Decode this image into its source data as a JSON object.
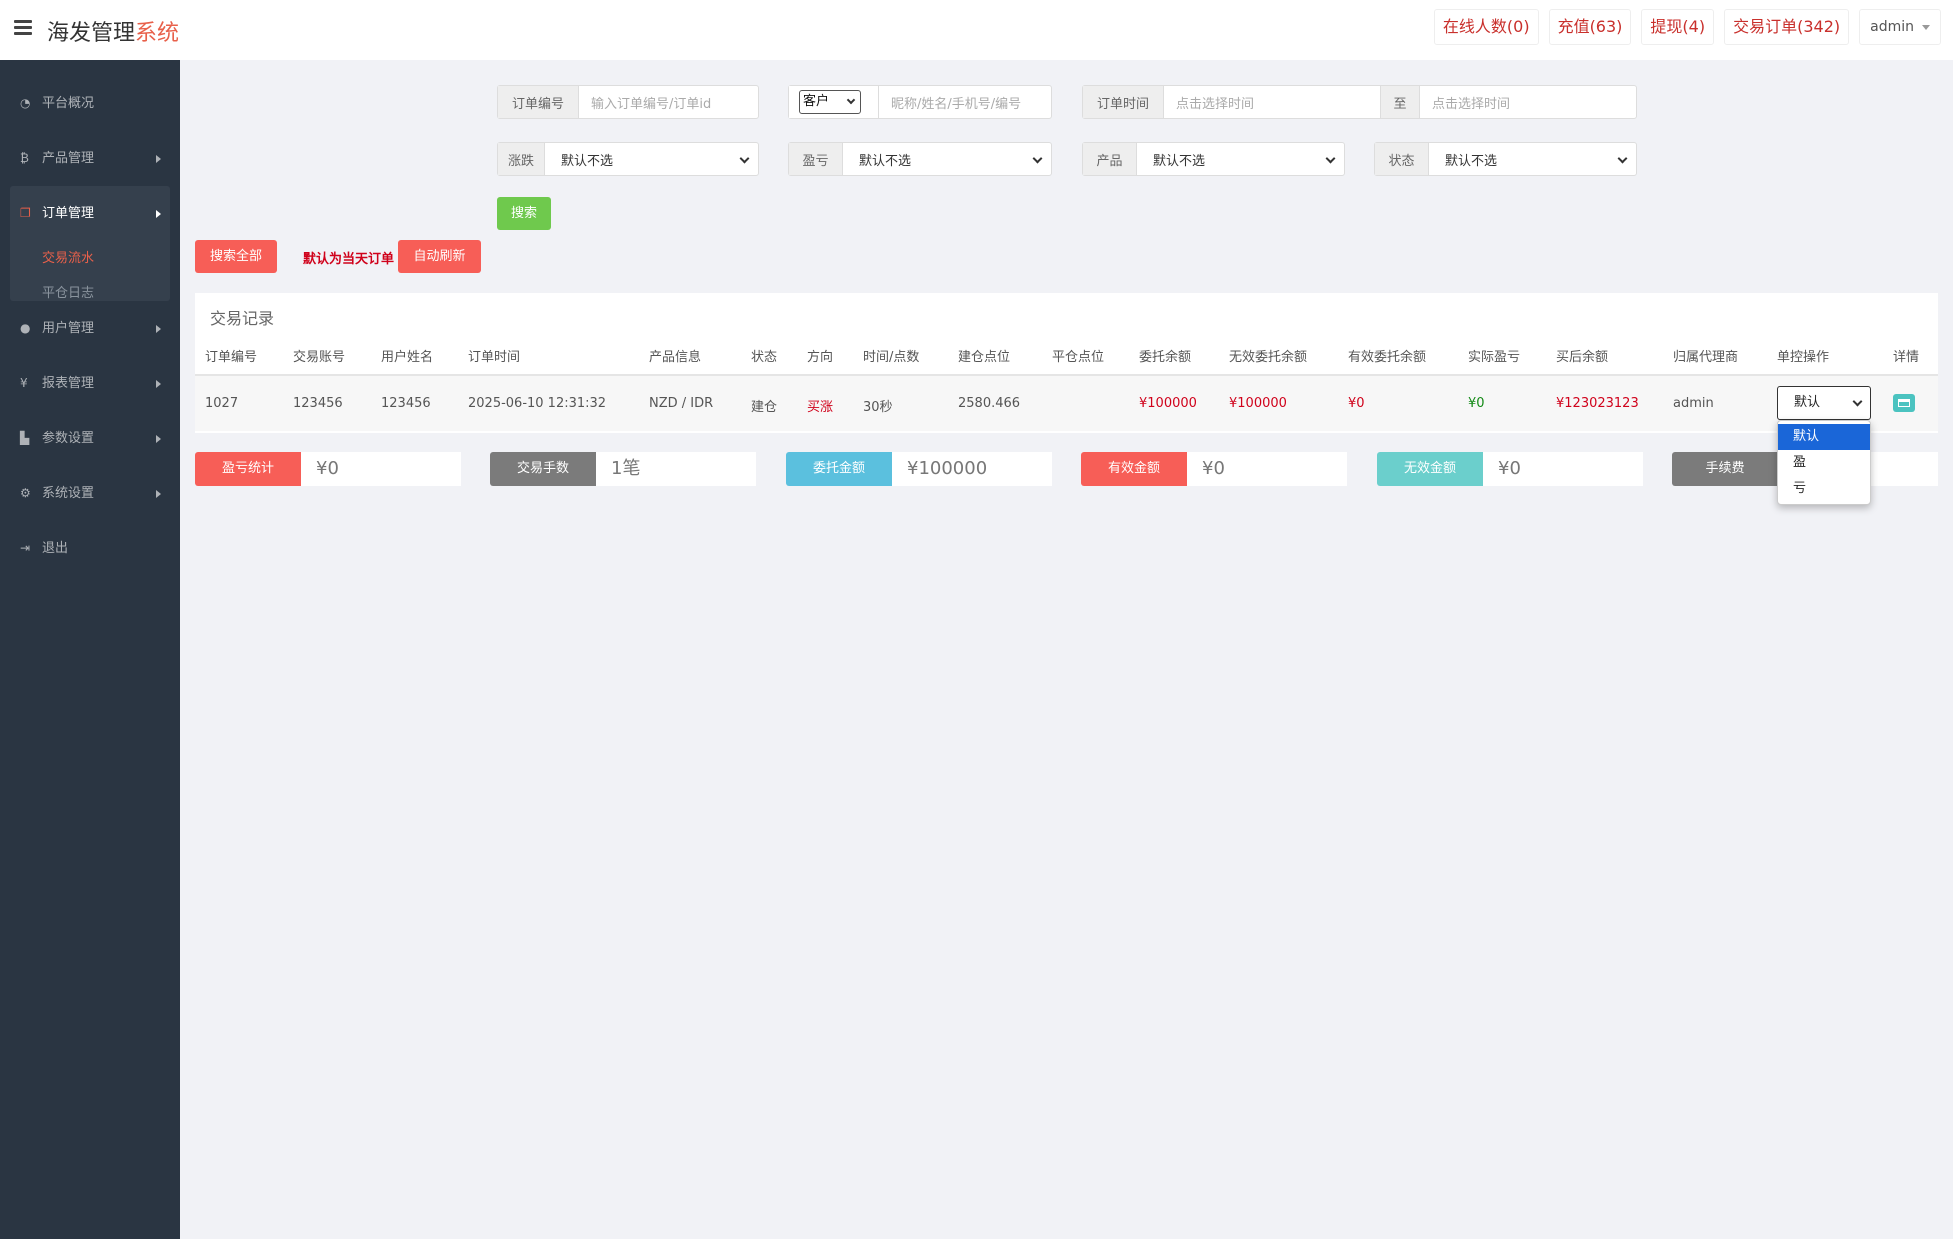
{
  "header": {
    "brand_main": "海发管理",
    "brand_accent": "系统",
    "online": "在线人数(0)",
    "recharge": "充值(63)",
    "withdraw": "提现(4)",
    "trade_orders": "交易订单(342)",
    "user": "admin"
  },
  "sidebar": {
    "overview": "平台概况",
    "product_mgmt": "产品管理",
    "order_mgmt": "订单管理",
    "trade_flow": "交易流水",
    "close_log": "平仓日志",
    "user_mgmt": "用户管理",
    "report_mgmt": "报表管理",
    "param_settings": "参数设置",
    "system_settings": "系统设置",
    "logout": "退出"
  },
  "filters": {
    "order_no_label": "订单编号",
    "order_no_placeholder": "输入订单编号/订单id",
    "customer_select": "客户",
    "customer_placeholder": "昵称/姓名/手机号/编号",
    "order_time_label": "订单时间",
    "time_start_placeholder": "点击选择时间",
    "to_label": "至",
    "time_end_placeholder": "点击选择时间",
    "rise_fall_label": "涨跌",
    "profit_loss_label": "盈亏",
    "product_label": "产品",
    "status_label": "状态",
    "default_option": "默认不选",
    "search_button": "搜索"
  },
  "actions": {
    "search_all": "搜索全部",
    "notice": "默认为当天订单",
    "auto_refresh": "自动刷新"
  },
  "table": {
    "title": "交易记录",
    "headers": [
      "订单编号",
      "交易账号",
      "用户姓名",
      "订单时间",
      "产品信息",
      "状态",
      "方向",
      "时间/点数",
      "建仓点位",
      "平仓点位",
      "委托余额",
      "无效委托余额",
      "有效委托余额",
      "实际盈亏",
      "买后余额",
      "归属代理商",
      "单控操作",
      "详情"
    ],
    "rows": [
      {
        "order_no": "1027",
        "account": "123456",
        "username": "123456",
        "time": "2025-06-10 12:31:32",
        "product": "NZD / IDR",
        "status": "建仓",
        "direction": "买涨",
        "duration": "30秒",
        "open_point": "2580.466",
        "close_point": "",
        "entrust": "¥100000",
        "invalid_entrust": "¥100000",
        "valid_entrust": "¥0",
        "actual_pl": "¥0",
        "balance_after": "¥123023123",
        "agent": "admin",
        "control": "默认"
      }
    ]
  },
  "stats": {
    "pl_label": "盈亏统计",
    "pl_value": "¥0",
    "lots_label": "交易手数",
    "lots_value": "1笔",
    "entrust_label": "委托金额",
    "entrust_value": "¥100000",
    "valid_label": "有效金额",
    "valid_value": "¥0",
    "invalid_label": "无效金额",
    "invalid_value": "¥0",
    "fee_label": "手续费",
    "fee_value": ""
  },
  "dropdown": {
    "options": [
      "默认",
      "盈",
      "亏"
    ],
    "selected_index": 0
  },
  "colors": {
    "sidebar_bg": "#2a3542",
    "accent_red": "#f75e57",
    "search_green": "#6fc94d",
    "stat_gray": "#7b7b7b",
    "stat_blue": "#5bc0de",
    "stat_teal": "#6bcfcc",
    "dropdown_highlight": "#1a66d8"
  }
}
